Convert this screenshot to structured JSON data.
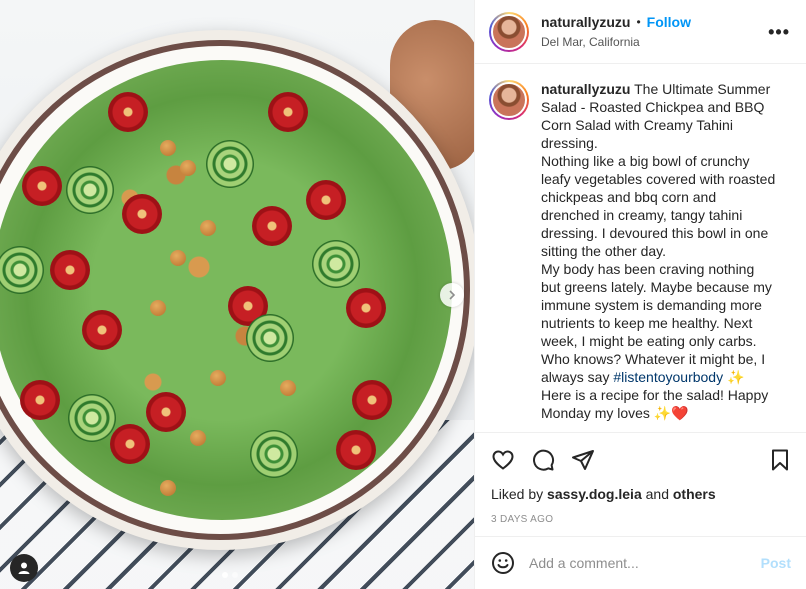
{
  "post": {
    "username": "naturallyzuzu",
    "follow_label": "Follow",
    "bullet": "•",
    "location": "Del Mar, California",
    "more_label": "•••",
    "caption_lines": [
      "The Ultimate Summer Salad - Roasted Chickpea and BBQ Corn Salad with Creamy Tahini dressing.",
      "Nothing like a big bowl of crunchy leafy vegetables covered with roasted chickpeas and bbq corn and drenched in creamy, tangy tahini dressing. I devoured this bowl in one sitting the other day.",
      "My body has been craving nothing but greens lately. Maybe because my immune system is demanding more nutrients to keep me healthy. Next week, I might be eating only carbs. Who knows? Whatever it might be, I always say",
      "#listentoyourbody",
      "✨",
      "Here is a recipe for the salad! Happy Monday my loves",
      "✨❤️"
    ],
    "likes_prefix": "Liked by",
    "liked_by": "sassy.dog.leia",
    "likes_mid": "and",
    "likes_others": "others",
    "time_ago": "3 DAYS AGO",
    "comment_placeholder": "Add a comment...",
    "post_label": "Post"
  },
  "icons": {
    "like": "heart-icon",
    "comment": "comment-icon",
    "share": "share-icon",
    "save": "bookmark-icon",
    "emoji": "smile-icon",
    "next": "chevron-right-icon",
    "tag": "user-tag-icon"
  },
  "carousel": {
    "current": 1,
    "total": 2
  },
  "colors": {
    "accent": "#0095f6",
    "hashtag": "#00376b",
    "muted": "#8e8e8e",
    "post_disabled": "#b2dffc"
  }
}
